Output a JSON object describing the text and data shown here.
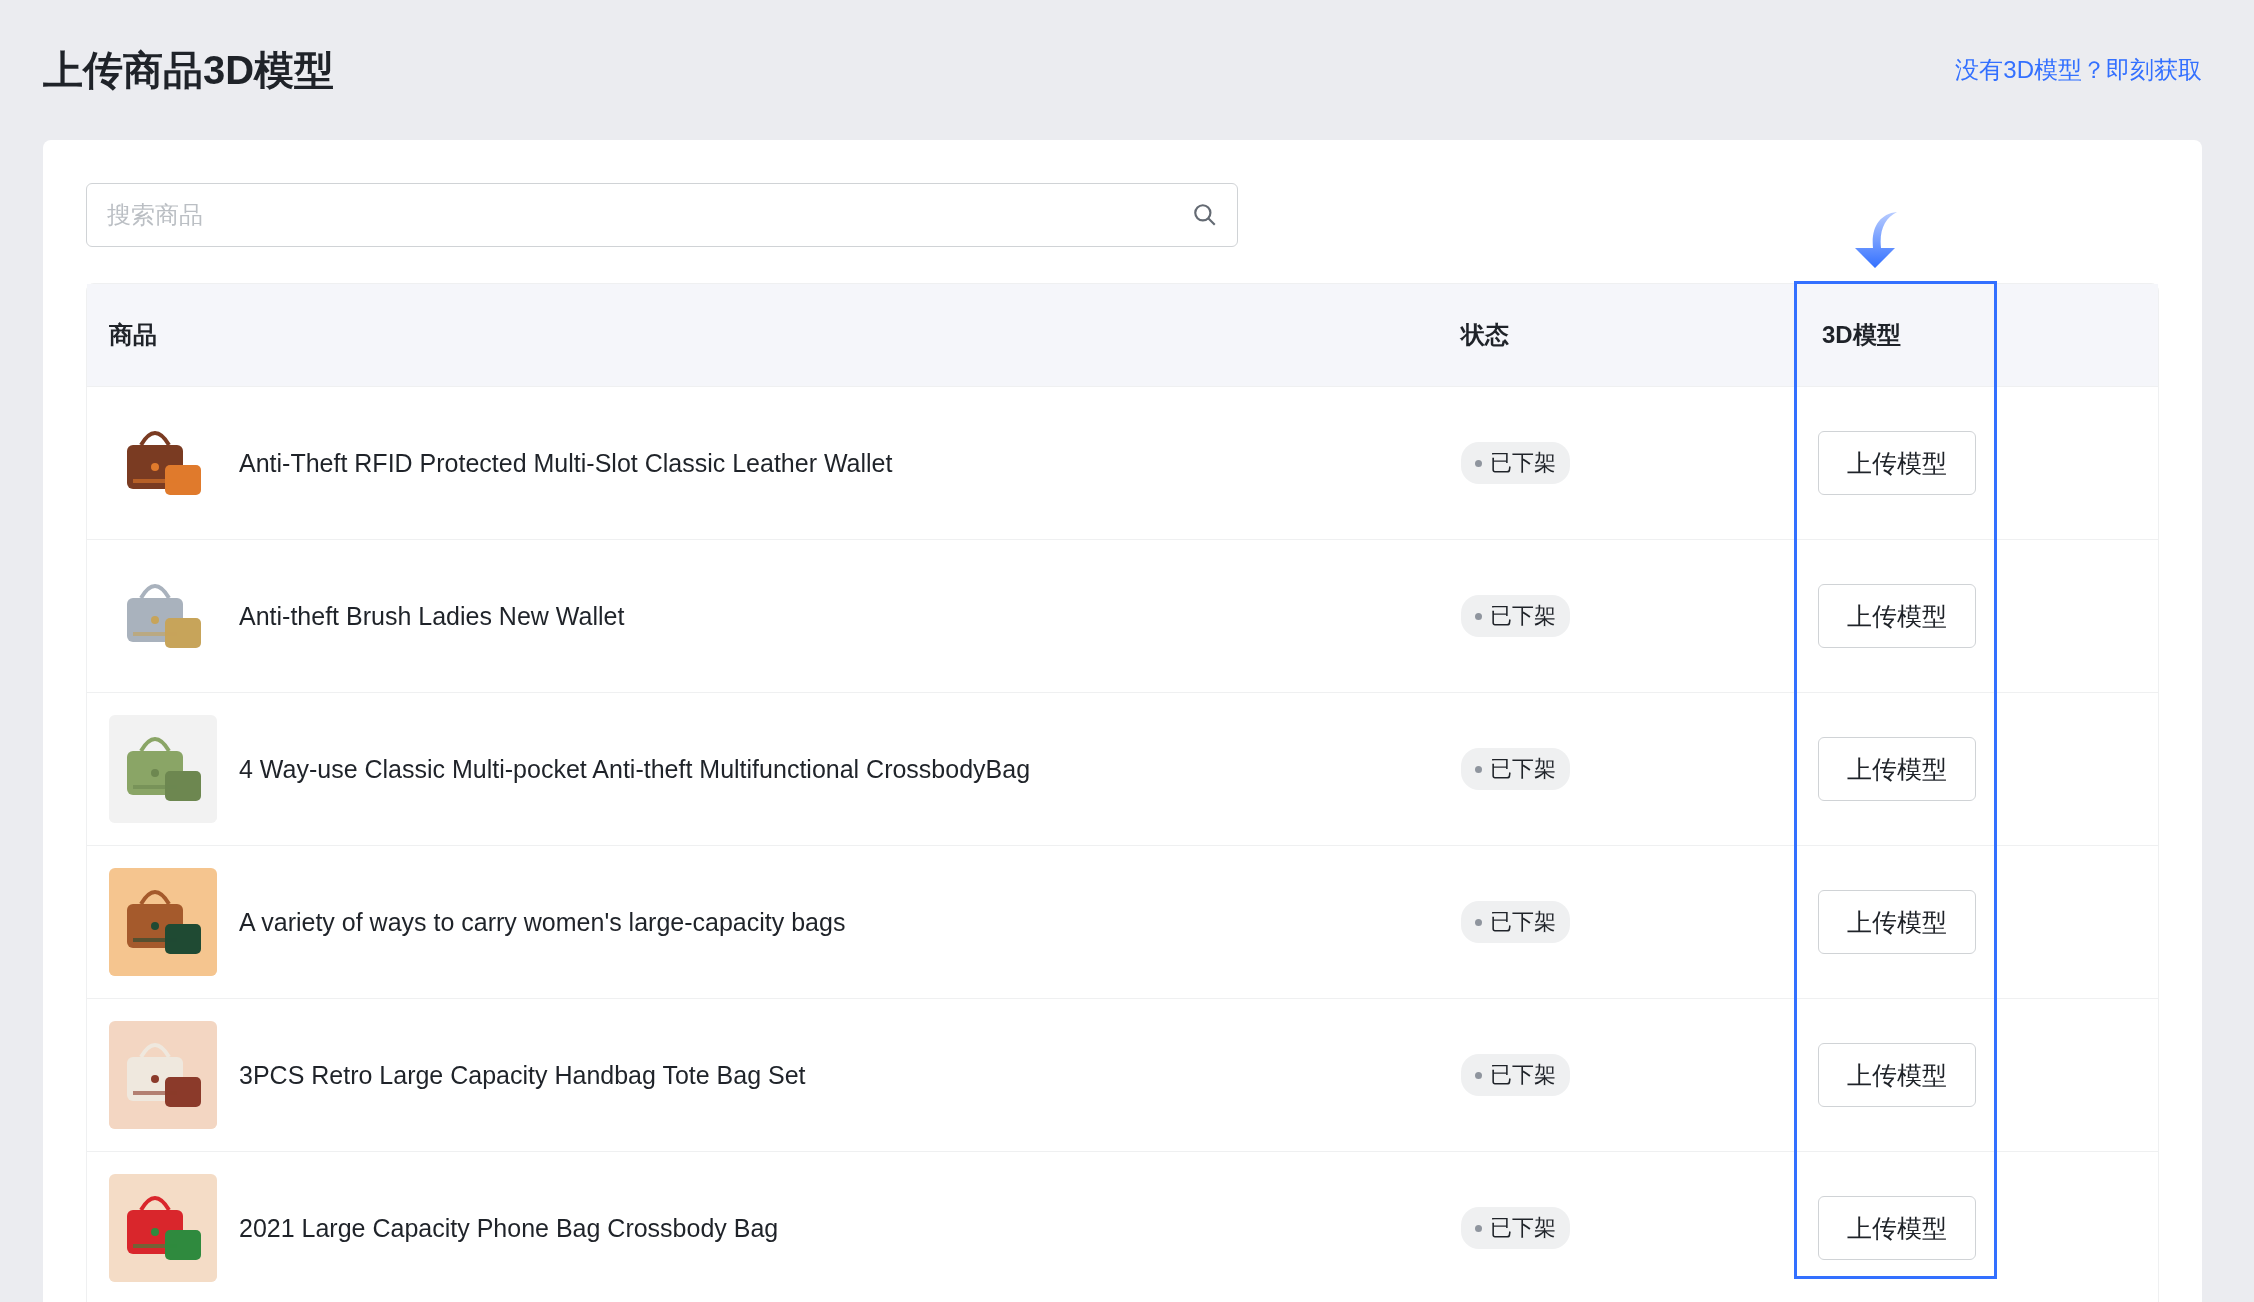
{
  "page": {
    "title": "上传商品3D模型",
    "help_link": "没有3D模型？即刻获取"
  },
  "search": {
    "placeholder": "搜索商品"
  },
  "table": {
    "columns": [
      "商品",
      "状态",
      "3D模型"
    ],
    "rows": [
      {
        "product": "Anti-Theft RFID Protected Multi-Slot Classic Leather Wallet",
        "status": "已下架",
        "action": "上传模型"
      },
      {
        "product": "Anti-theft Brush Ladies New Wallet",
        "status": "已下架",
        "action": "上传模型"
      },
      {
        "product": "4 Way-use Classic Multi-pocket Anti-theft Multifunctional CrossbodyBag",
        "status": "已下架",
        "action": "上传模型"
      },
      {
        "product": "A variety of ways to carry women's large-capacity bags",
        "status": "已下架",
        "action": "上传模型"
      },
      {
        "product": "3PCS Retro Large Capacity Handbag Tote Bag Set",
        "status": "已下架",
        "action": "上传模型"
      },
      {
        "product": "2021 Large Capacity Phone Bag Crossbody Bag",
        "status": "已下架",
        "action": "上传模型"
      }
    ]
  }
}
